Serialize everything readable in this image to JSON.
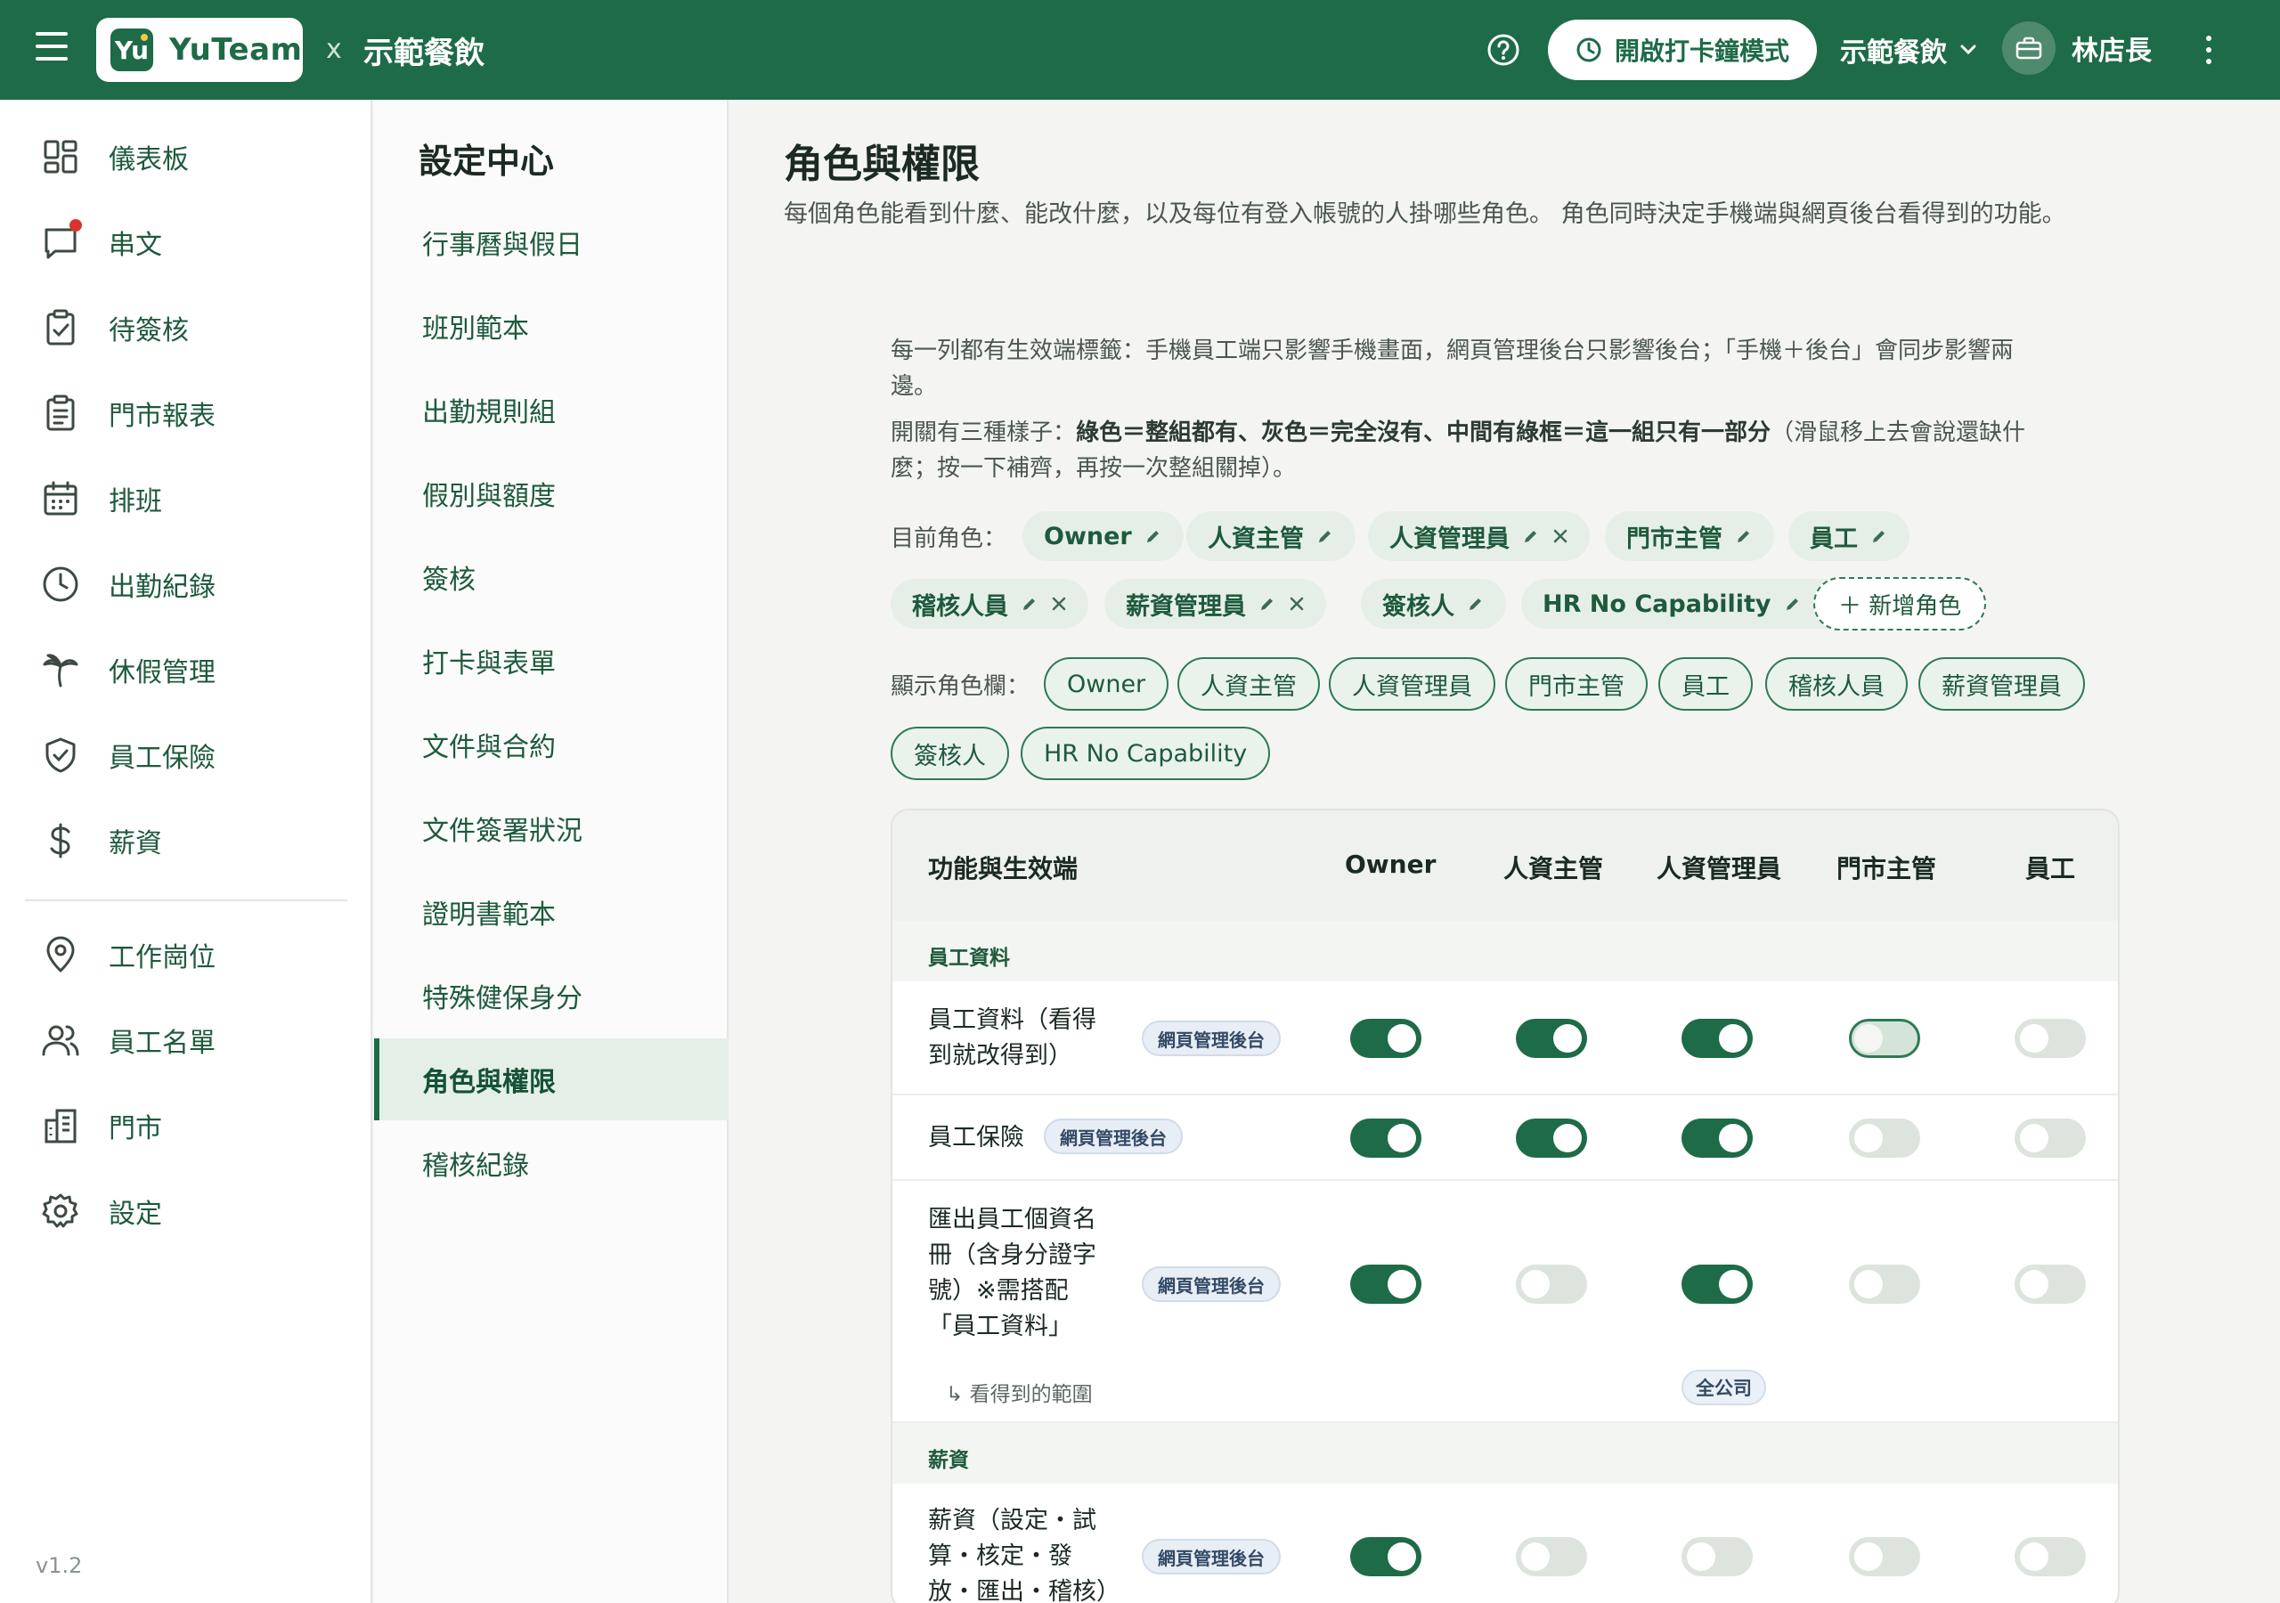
{
  "header": {
    "logo_badge": "Yu",
    "logo_text": "YuTeam",
    "separator": "x",
    "company": "示範餐飲",
    "clock_button": "開啟打卡鐘模式",
    "store_select": "示範餐飲",
    "user_name": "林店長",
    "icons": [
      "menu-icon",
      "help-icon",
      "clock-icon",
      "chevron-down-icon",
      "briefcase-icon",
      "more-vertical-icon"
    ]
  },
  "sidebar": {
    "items": [
      {
        "label": "儀表板",
        "icon": "dashboard-icon"
      },
      {
        "label": "串文",
        "icon": "chat-icon",
        "badge": true
      },
      {
        "label": "待簽核",
        "icon": "clipboard-check-icon"
      },
      {
        "label": "門市報表",
        "icon": "report-icon"
      },
      {
        "label": "排班",
        "icon": "calendar-icon"
      },
      {
        "label": "出勤紀錄",
        "icon": "clock-icon"
      },
      {
        "label": "休假管理",
        "icon": "palm-tree-icon"
      },
      {
        "label": "員工保險",
        "icon": "shield-icon"
      },
      {
        "label": "薪資",
        "icon": "dollar-icon"
      },
      {
        "label": "工作崗位",
        "icon": "location-pin-icon"
      },
      {
        "label": "員工名單",
        "icon": "users-icon"
      },
      {
        "label": "門市",
        "icon": "building-icon"
      },
      {
        "label": "設定",
        "icon": "gear-icon"
      }
    ],
    "version": "v1.2"
  },
  "settings": {
    "title": "設定中心",
    "items": [
      {
        "label": "行事曆與假日"
      },
      {
        "label": "班別範本"
      },
      {
        "label": "出勤規則組"
      },
      {
        "label": "假別與額度"
      },
      {
        "label": "簽核"
      },
      {
        "label": "打卡與表單"
      },
      {
        "label": "文件與合約"
      },
      {
        "label": "文件簽署狀況"
      },
      {
        "label": "證明書範本"
      },
      {
        "label": "特殊健保身分"
      },
      {
        "label": "角色與權限",
        "active": true
      },
      {
        "label": "稽核紀錄"
      }
    ]
  },
  "main": {
    "title": "角色與權限",
    "description": "每個角色能看到什麼、能改什麼，以及每位有登入帳號的人掛哪些角色。 角色同時決定手機端與網頁後台看得到的功能。",
    "help1_line1": "每一列都有生效端標籤：手機員工端只影響手機畫面，網頁管理後台只影響後台；「手機＋後台」會同步影響兩",
    "help1_line2": "邊。",
    "help2_prefix": "開關有三種樣子：",
    "help2_bold": "綠色＝整組都有、灰色＝完全沒有、中間有綠框＝這一組只有一部分",
    "help2_suffix": "（滑鼠移上去會說還缺什",
    "help2_line2": "麼；按一下補齊，再按一次整組關掉）。",
    "current_roles_label": "目前角色：",
    "roles": [
      {
        "name": "Owner",
        "removable": false
      },
      {
        "name": "人資主管",
        "removable": false
      },
      {
        "name": "人資管理員",
        "removable": true
      },
      {
        "name": "門市主管",
        "removable": false
      },
      {
        "name": "員工",
        "removable": false
      },
      {
        "name": "稽核人員",
        "removable": true
      },
      {
        "name": "薪資管理員",
        "removable": true
      },
      {
        "name": "簽核人",
        "removable": false
      },
      {
        "name": "HR No Capability",
        "removable": true
      }
    ],
    "add_role": "＋ 新增角色",
    "display_cols_label": "顯示角色欄：",
    "display_cols": [
      "Owner",
      "人資主管",
      "人資管理員",
      "門市主管",
      "員工",
      "稽核人員",
      "薪資管理員",
      "簽核人",
      "HR No Capability"
    ]
  },
  "table": {
    "headers": [
      "功能與生效端",
      "Owner",
      "人資主管",
      "人資管理員",
      "門市主管",
      "員工"
    ],
    "sections": [
      {
        "label": "員工資料",
        "rows": [
          {
            "name_lines": [
              "員工資料（看得",
              "到就改得到）"
            ],
            "scope": "網頁管理後台",
            "states": [
              "on",
              "on",
              "on",
              "partial",
              "off"
            ]
          },
          {
            "name_lines": [
              "員工保險"
            ],
            "scope": "網頁管理後台",
            "states": [
              "on",
              "on",
              "on",
              "off",
              "off"
            ]
          },
          {
            "name_lines": [
              "匯出員工個資名",
              "冊（含身分證字",
              "號）※需搭配",
              "「員工資料」"
            ],
            "scope": "網頁管理後台",
            "states": [
              "on",
              "off",
              "on",
              "off",
              "off"
            ],
            "subnote": "↳ 看得到的範圍",
            "subnote_value": "全公司"
          }
        ]
      },
      {
        "label": "薪資",
        "rows": [
          {
            "name_lines": [
              "薪資（設定・試",
              "算・核定・發",
              "放・匯出・稽核）"
            ],
            "scope": "網頁管理後台",
            "states": [
              "on",
              "off",
              "off",
              "off",
              "off"
            ]
          }
        ]
      }
    ]
  },
  "colors": {
    "primary": "#1e6b47",
    "chip_bg": "#e5efe8",
    "toggle_off": "#dde3dd",
    "danger_dot": "#d9342b"
  }
}
